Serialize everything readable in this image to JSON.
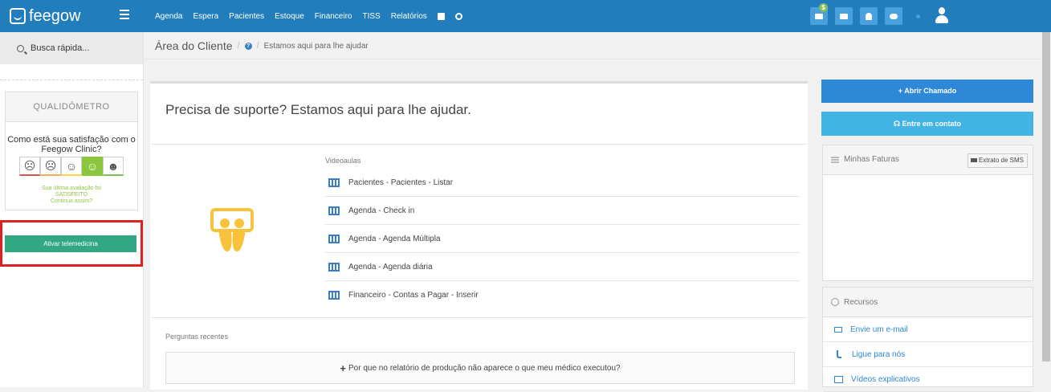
{
  "app": {
    "logo_text": "feegow"
  },
  "nav": {
    "items": [
      "Agenda",
      "Espera",
      "Pacientes",
      "Estoque",
      "Financeiro",
      "TISS",
      "Relatórios"
    ]
  },
  "topbar": {
    "badge": "$"
  },
  "sidebar": {
    "search_label": "Busca rápida...",
    "qualidometro": {
      "title": "QUALIDÔMETRO",
      "question": "Como está sua satisfação com o Feegow Clinic?",
      "faces": [
        "☹",
        "☹",
        "☺",
        "☺",
        "☻"
      ],
      "last_line1": "Sua última avaliação foi",
      "last_line2": "SATISFEITO",
      "last_line3": "Continua assim?"
    },
    "tele_button": "Ativar telemedicina"
  },
  "breadcrumb": {
    "title": "Área do Cliente",
    "sub": "Estamos aqui para lhe ajudar"
  },
  "main": {
    "heading": "Precisa de suporte? Estamos aqui para lhe ajudar.",
    "videos_label": "Videoaulas",
    "videos": [
      "Pacientes - Pacientes - Listar",
      "Agenda - Check in",
      "Agenda - Agenda Múltipla",
      "Agenda - Agenda diária",
      "Financeiro - Contas a Pagar - Inserir"
    ],
    "recent_label": "Perguntas recentes",
    "recent_question": "Por que no relatório de produção não aparece o que meu médico executou?"
  },
  "right": {
    "open_ticket": "+ Abrir Chamado",
    "contact": "Entre em contato",
    "invoices_title": "Minhas Faturas",
    "sms_button": "Extrato de SMS",
    "resources_title": "Recursos",
    "resources": [
      "Envie um e-mail",
      "Ligue para nós",
      "Vídeos explicativos"
    ]
  },
  "colors": {
    "topbar": "#217dbb",
    "telemedicine": "#32a783",
    "open_ticket": "#2e88d8",
    "contact": "#42b3e5",
    "highlight": "#e02020"
  }
}
